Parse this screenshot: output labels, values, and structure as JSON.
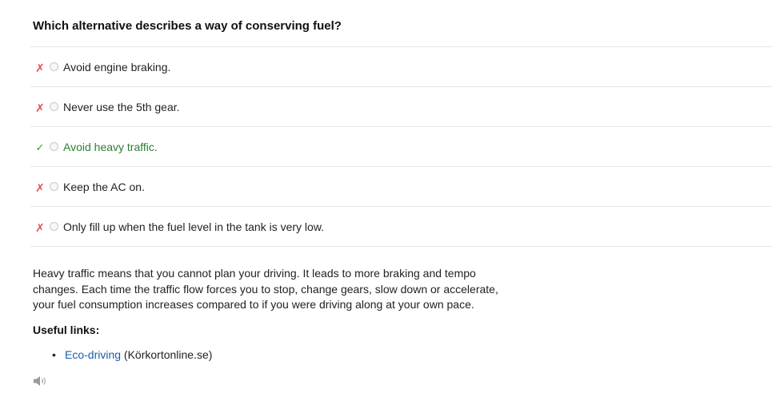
{
  "question": {
    "text": "Which alternative describes a way of conserving fuel?"
  },
  "options": [
    {
      "mark": "✗",
      "status": "wrong",
      "text": "Avoid engine braking."
    },
    {
      "mark": "✗",
      "status": "wrong",
      "text": "Never use the 5th gear."
    },
    {
      "mark": "✓",
      "status": "correct",
      "text": "Avoid heavy traffic."
    },
    {
      "mark": "✗",
      "status": "wrong",
      "text": "Keep the AC on."
    },
    {
      "mark": "✗",
      "status": "wrong",
      "text": "Only fill up when the fuel level in the tank is very low."
    }
  ],
  "explanation": {
    "text": "Heavy traffic means that you cannot plan your driving. It leads to more braking and tempo changes. Each time the traffic flow forces you to stop, change gears, slow down or accelerate, your fuel consumption increases compared to if you were driving along at your own pace."
  },
  "useful_links": {
    "heading": "Useful links:",
    "items": [
      {
        "bullet": "•",
        "link_text": "Eco-driving",
        "source": "(Körkortonline.se)"
      }
    ]
  },
  "audio": {
    "icon": "speaker-icon"
  },
  "colors": {
    "wrong_mark": "#e0524f",
    "correct_mark": "#3a9a3a",
    "correct_text": "#2e7d32",
    "link": "#1a5fa8",
    "divider": "#e6e6e6"
  }
}
